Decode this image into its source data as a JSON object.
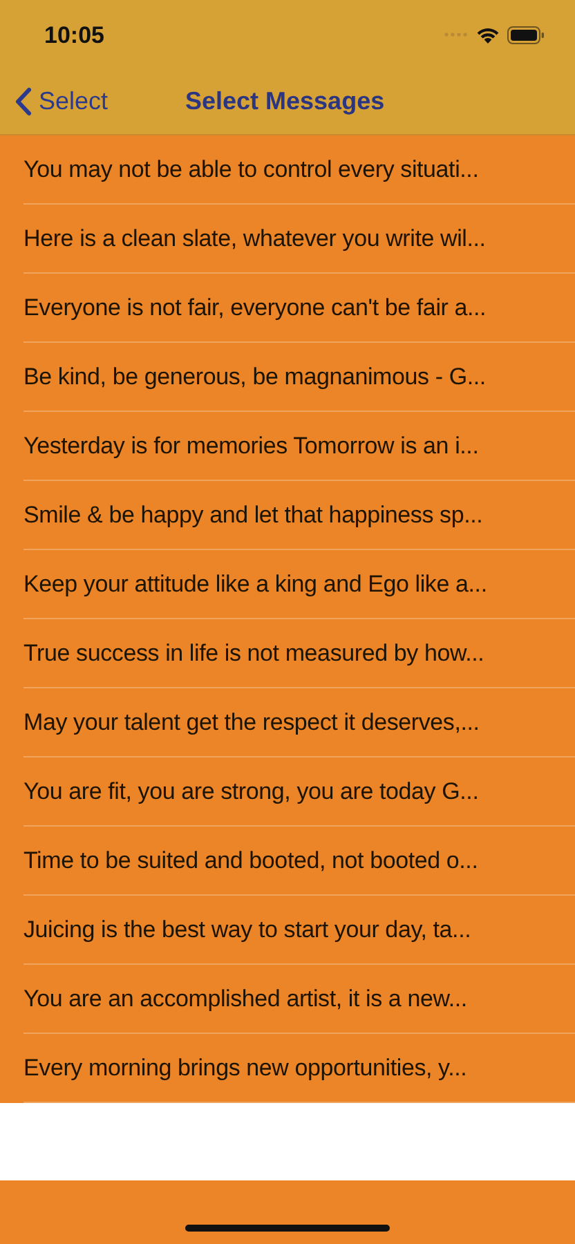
{
  "status_bar": {
    "time": "10:05"
  },
  "nav_bar": {
    "back_label": "Select",
    "title": "Select Messages"
  },
  "messages": [
    {
      "text": "You may not be able to control every situati..."
    },
    {
      "text": "Here is a clean slate, whatever you write wil..."
    },
    {
      "text": "Everyone is not fair, everyone can't be fair a..."
    },
    {
      "text": "Be kind, be generous, be magnanimous - G..."
    },
    {
      "text": "Yesterday is for memories Tomorrow is an i..."
    },
    {
      "text": "Smile & be happy and let that happiness sp..."
    },
    {
      "text": "Keep your attitude like a king and Ego like a..."
    },
    {
      "text": "True success in life is not measured by how..."
    },
    {
      "text": "May your talent get the respect it deserves,..."
    },
    {
      "text": "You are fit, you are strong, you are today G..."
    },
    {
      "text": "Time to be suited and booted, not booted o..."
    },
    {
      "text": "Juicing is the best way to start your day, ta..."
    },
    {
      "text": "You are an accomplished artist, it is a new..."
    },
    {
      "text": "Every morning brings new opportunities, y..."
    }
  ]
}
